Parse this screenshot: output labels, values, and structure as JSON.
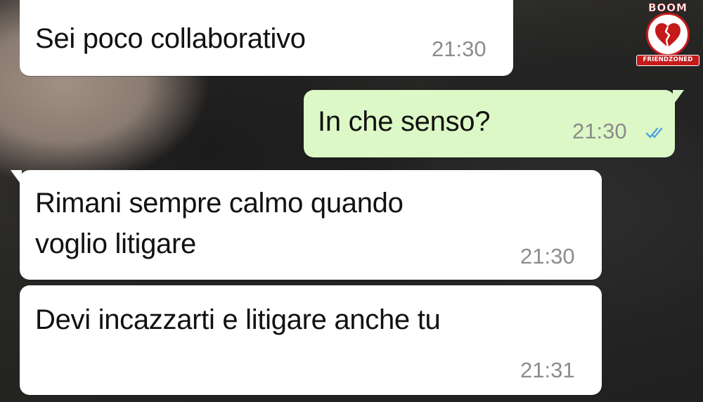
{
  "chat": {
    "messages": [
      {
        "direction": "incoming",
        "text": "Sei poco collaborativo",
        "time": "21:30"
      },
      {
        "direction": "outgoing",
        "text": "In che senso?",
        "time": "21:30",
        "status": "read-double-check-icon"
      },
      {
        "direction": "incoming",
        "lines": [
          "Rimani sempre calmo quando",
          "voglio litigare"
        ],
        "time": "21:30"
      },
      {
        "direction": "incoming",
        "text": "Devi incazzarti e litigare anche tu",
        "time": "21:31"
      }
    ]
  },
  "watermark": {
    "top_text": "BOOM",
    "banner_text": "FRIENDZONED",
    "icon": "broken-heart-icon"
  },
  "colors": {
    "incoming_bubble": "#ffffff",
    "outgoing_bubble": "#dcf8c6",
    "timestamp": "#8c8c8c",
    "read_ticks": "#4fa3e0",
    "watermark_red": "#c41a1a"
  }
}
